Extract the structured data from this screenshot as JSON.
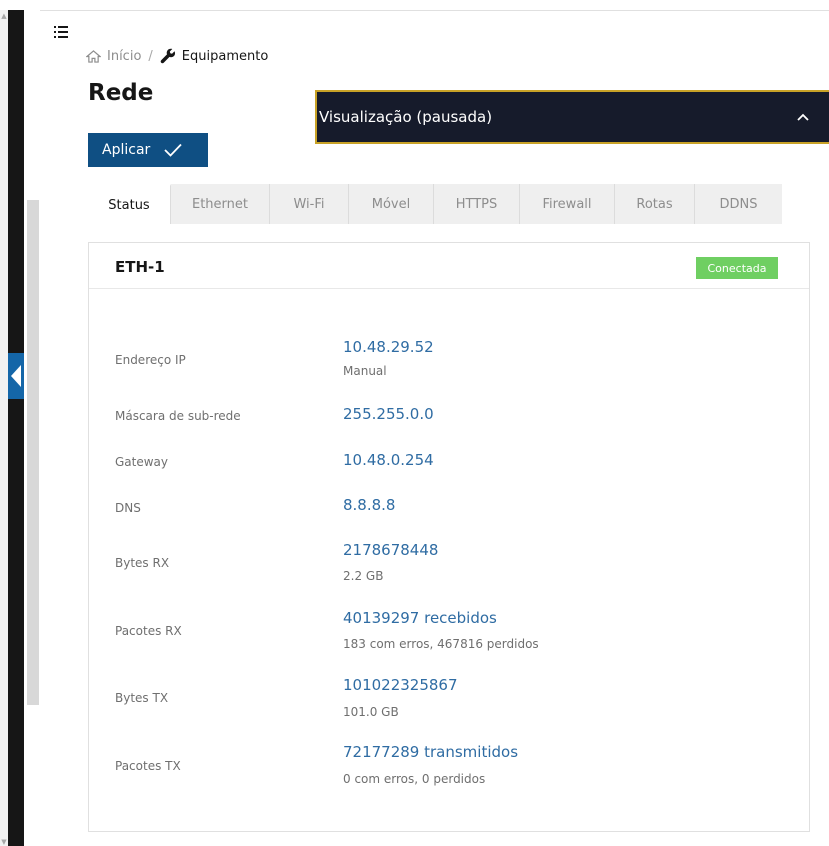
{
  "breadcrumb": {
    "home": "Início",
    "separator": "/",
    "current": "Equipamento"
  },
  "page": {
    "title": "Rede"
  },
  "preview": {
    "title": "Visualização (pausada)"
  },
  "toolbar": {
    "apply_label": "Aplicar"
  },
  "tabs": [
    "Status",
    "Ethernet",
    "Wi-Fi",
    "Móvel",
    "HTTPS",
    "Firewall",
    "Rotas",
    "DDNS"
  ],
  "interface": {
    "name": "ETH-1",
    "status": "Conectada",
    "status_color": "#6fcf62",
    "rows": [
      {
        "label": "Endereço IP",
        "value": "10.48.29.52",
        "sub": "Manual"
      },
      {
        "label": "Máscara de sub-rede",
        "value": "255.255.0.0",
        "sub": ""
      },
      {
        "label": "Gateway",
        "value": "10.48.0.254",
        "sub": ""
      },
      {
        "label": "DNS",
        "value": "8.8.8.8",
        "sub": ""
      },
      {
        "label": "Bytes RX",
        "value": "2178678448",
        "sub": "2.2 GB"
      },
      {
        "label": "Pacotes RX",
        "value": "40139297 recebidos",
        "sub": "183 com erros, 467816 perdidos"
      },
      {
        "label": "Bytes TX",
        "value": "101022325867",
        "sub": "101.0 GB"
      },
      {
        "label": "Pacotes TX",
        "value": "72177289 transmitidos",
        "sub": "0 com erros, 0 perdidos"
      }
    ]
  },
  "colors": {
    "accent": "#0f4f83",
    "value_text": "#2f6ca3",
    "preview_bg": "#161b2b",
    "preview_border": "#c8a227"
  },
  "icons": [
    "menu-icon",
    "home-icon",
    "wrench-icon",
    "checkmark-icon",
    "chevron-up-icon",
    "chevron-left-icon"
  ]
}
